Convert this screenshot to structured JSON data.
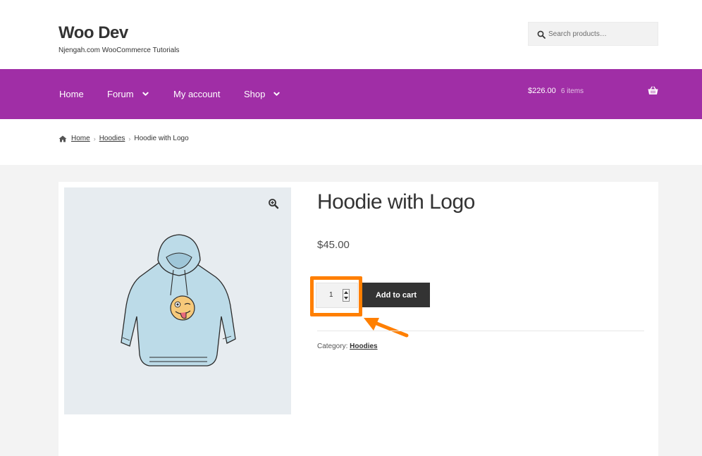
{
  "site": {
    "title": "Woo Dev",
    "tagline": "Njengah.com WooCommerce Tutorials"
  },
  "search": {
    "placeholder": "Search products…",
    "icon": "search-icon"
  },
  "nav": {
    "items": [
      {
        "label": "Home",
        "has_dropdown": false
      },
      {
        "label": "Forum",
        "has_dropdown": true
      },
      {
        "label": "My account",
        "has_dropdown": false
      },
      {
        "label": "Shop",
        "has_dropdown": true
      }
    ],
    "background": "#a02ea6"
  },
  "cart": {
    "total": "$226.00",
    "count": "6 items",
    "icon": "basket-icon"
  },
  "breadcrumb": {
    "items": [
      "Home",
      "Hoodies"
    ],
    "current": "Hoodie with Logo"
  },
  "product": {
    "title": "Hoodie with Logo",
    "price": "$45.00",
    "quantity": "1",
    "add_to_cart_label": "Add to cart",
    "category_label": "Category:",
    "category": "Hoodies"
  },
  "annotation": {
    "highlight_color": "#ff7f00"
  }
}
